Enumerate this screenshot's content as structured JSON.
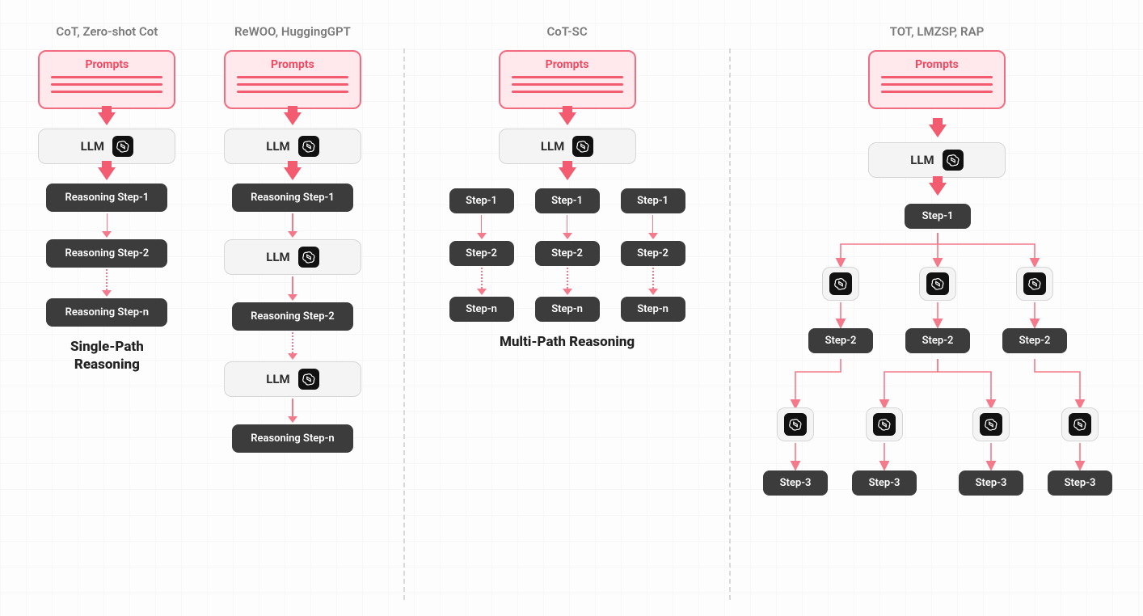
{
  "headers": {
    "cot": "CoT, Zero-shot Cot",
    "rewoo": "ReWOO, HuggingGPT",
    "cotsc": "CoT-SC",
    "tot": "TOT, LMZSP, RAP"
  },
  "prompts_title": "Prompts",
  "llm_label": "LLM",
  "single": {
    "step1": "Reasoning Step-1",
    "step2": "Reasoning Step-2",
    "stepn": "Reasoning Step-n",
    "caption": "Single-Path\nReasoning"
  },
  "rewoo": {
    "step1": "Reasoning Step-1",
    "step2": "Reasoning Step-2",
    "stepn": "Reasoning Step-n"
  },
  "cotsc": {
    "step1": "Step-1",
    "step2": "Step-2",
    "stepn": "Step-n",
    "caption": "Multi-Path Reasoning"
  },
  "tree": {
    "step1": "Step-1",
    "step2": "Step-2",
    "step3": "Step-3"
  }
}
